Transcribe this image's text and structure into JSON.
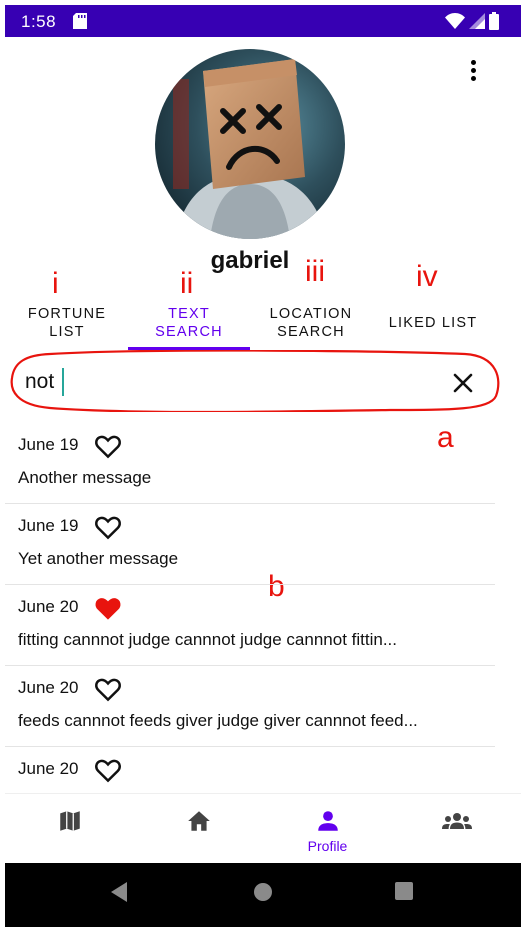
{
  "status_bar": {
    "time": "1:58",
    "icons": [
      "sd-card-icon",
      "wifi-icon",
      "signal-icon",
      "battery-icon"
    ]
  },
  "profile": {
    "username": "gabriel",
    "avatar": "avatar-image"
  },
  "annotations": {
    "tab_markers": [
      "i",
      "ii",
      "iii",
      "iv"
    ],
    "search_marker": "a",
    "list_marker": "b"
  },
  "tabs": [
    {
      "line1": "FORTUNE",
      "line2": "LIST",
      "active": false
    },
    {
      "line1": "TEXT",
      "line2": "SEARCH",
      "active": true
    },
    {
      "line1": "LOCATION",
      "line2": "SEARCH",
      "active": false
    },
    {
      "line1": "LIKED LIST",
      "line2": "",
      "active": false
    }
  ],
  "search": {
    "value": "not"
  },
  "results": [
    {
      "date": "June 19",
      "message": "Another message",
      "liked": false
    },
    {
      "date": "June 19",
      "message": "Yet another message",
      "liked": false
    },
    {
      "date": "June 20",
      "message": "fitting cannnot judge cannnot judge cannnot fittin...",
      "liked": true
    },
    {
      "date": "June 20",
      "message": "feeds cannnot feeds giver judge giver cannnot feed...",
      "liked": false
    },
    {
      "date": "June 20",
      "message": "",
      "liked": false
    }
  ],
  "bottom_nav": {
    "items": [
      {
        "icon": "map-icon",
        "label": ""
      },
      {
        "icon": "home-icon",
        "label": ""
      },
      {
        "icon": "person-icon",
        "label": "Profile"
      },
      {
        "icon": "group-icon",
        "label": ""
      }
    ]
  },
  "colors": {
    "status_bar": "#3700b3",
    "accent": "#6200ee",
    "annotation": "#e8140e",
    "heart_liked": "#e8140e",
    "caret": "#26a69a"
  },
  "system_nav": [
    "back-icon",
    "home-circle-icon",
    "recents-icon"
  ]
}
